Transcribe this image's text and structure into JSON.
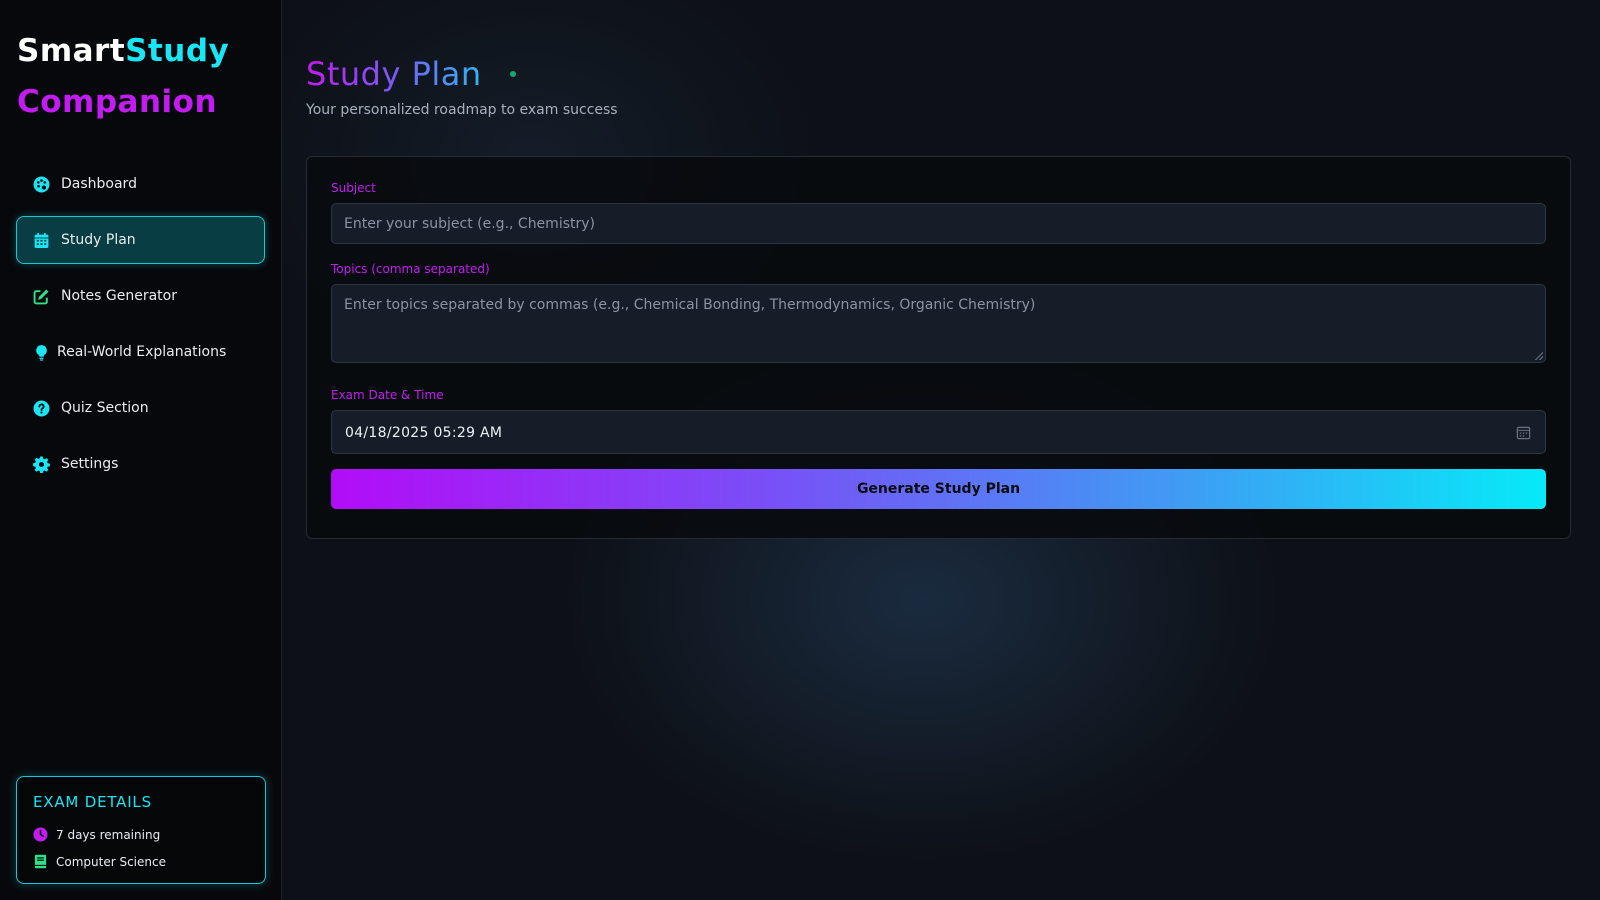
{
  "brand": {
    "part1": "Smart",
    "part2": "Study",
    "part3": "Companion"
  },
  "sidebar": {
    "items": [
      {
        "label": "Dashboard",
        "icon": "palette-icon",
        "icon_color": "#19e6f5"
      },
      {
        "label": "Study Plan",
        "icon": "calendar-icon",
        "icon_color": "#19e6f5",
        "active": true
      },
      {
        "label": "Notes Generator",
        "icon": "edit-icon",
        "icon_color": "#2ee08a"
      },
      {
        "label": "Real-World Explanations",
        "icon": "lightbulb-icon",
        "icon_color": "#19e6f5"
      },
      {
        "label": "Quiz Section",
        "icon": "question-circle-icon",
        "icon_color": "#19e6f5"
      },
      {
        "label": "Settings",
        "icon": "gear-icon",
        "icon_color": "#19e6f5"
      }
    ]
  },
  "exam_details": {
    "title": "EXAM DETAILS",
    "days_remaining": "7 days remaining",
    "subject": "Computer Science"
  },
  "main": {
    "title": "Study Plan",
    "subtitle": "Your personalized roadmap to exam success"
  },
  "form": {
    "subject_label": "Subject",
    "subject_placeholder": "Enter your subject (e.g., Chemistry)",
    "topics_label": "Topics (comma separated)",
    "topics_placeholder": "Enter topics separated by commas (e.g., Chemical Bonding, Thermodynamics, Organic Chemistry)",
    "exam_label": "Exam Date & Time",
    "exam_value": "04/18/2025 05:29 AM",
    "submit_label": "Generate Study Plan"
  },
  "colors": {
    "accent_cyan": "#19e6f5",
    "accent_purple": "#c21cf2",
    "accent_green": "#2ee08a",
    "background": "#0d1016"
  }
}
